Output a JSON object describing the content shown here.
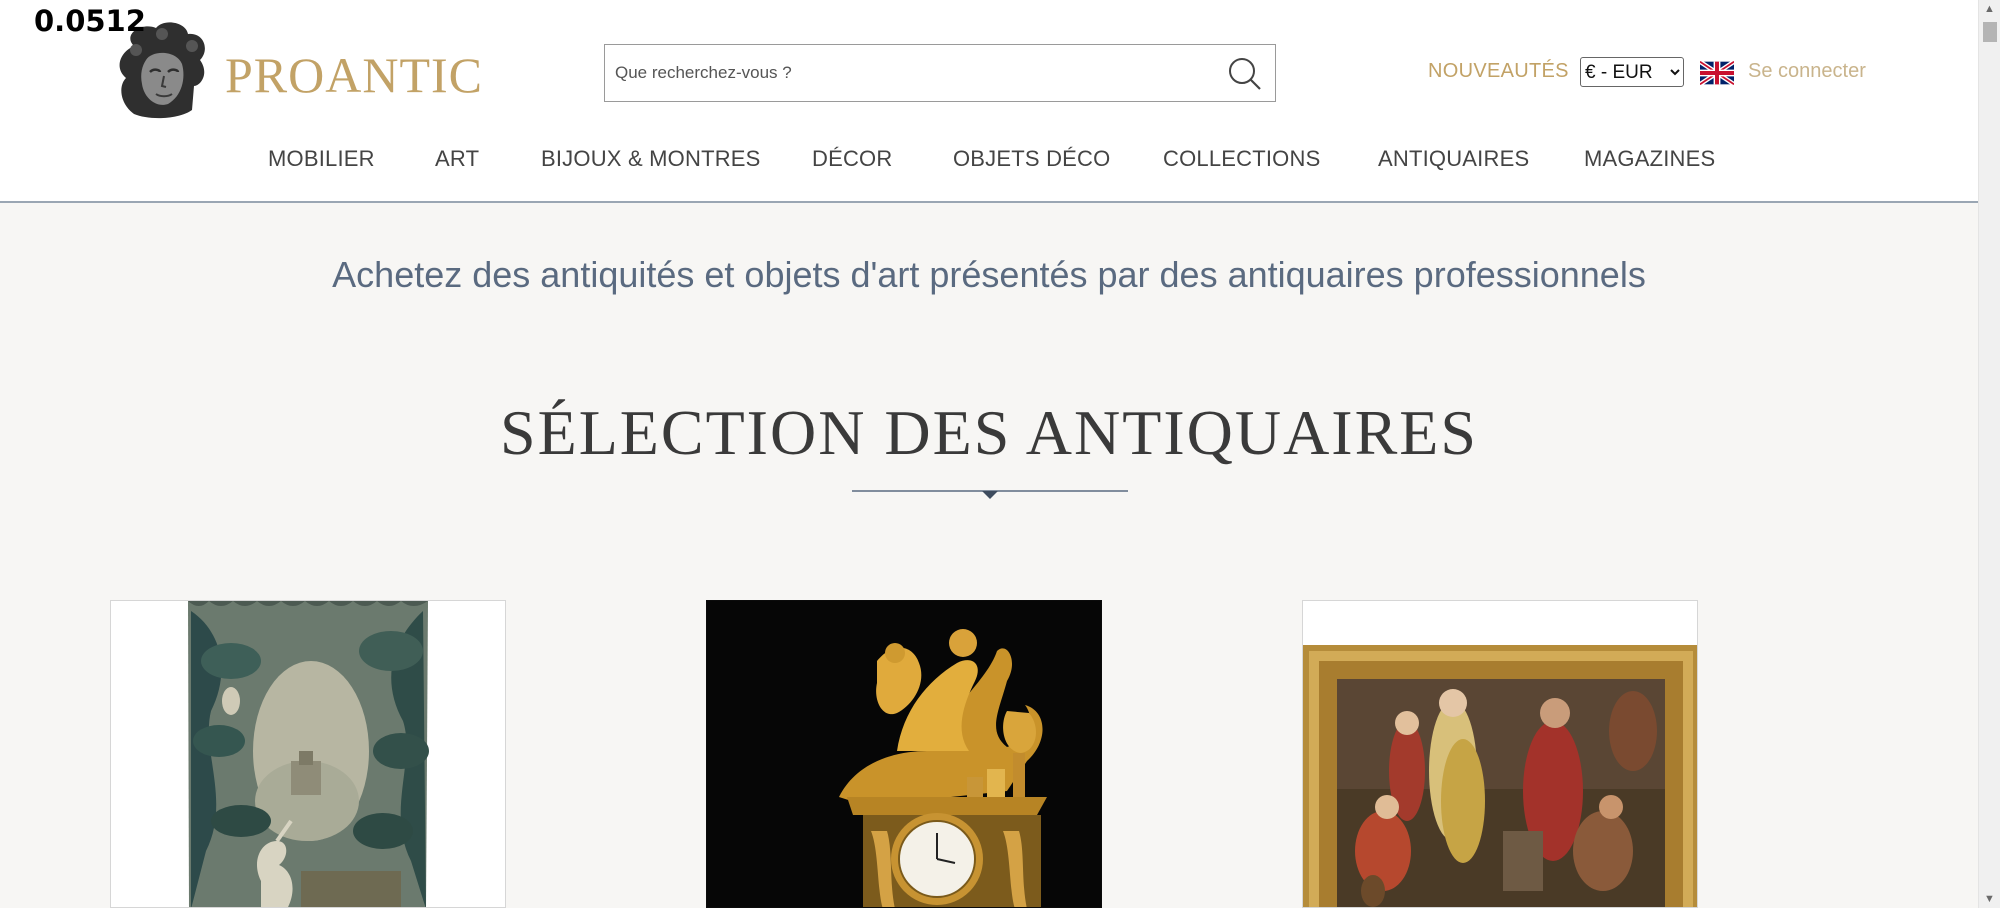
{
  "overlay_value": "0.0512",
  "brand": {
    "name": "PROANTIC",
    "logo_icon": "classical-head-bust-logo"
  },
  "search": {
    "placeholder": "Que recherchez-vous ?",
    "icon": "search-icon"
  },
  "header": {
    "new_label": "NOUVEAUTÉS",
    "currency_selected": "€ - EUR",
    "language_icon": "uk-flag-icon",
    "login_label": "Se connecter"
  },
  "nav": {
    "items": [
      {
        "label": "MOBILIER"
      },
      {
        "label": "ART"
      },
      {
        "label": "BIJOUX & MONTRES"
      },
      {
        "label": "DÉCOR"
      },
      {
        "label": "OBJETS DÉCO"
      },
      {
        "label": "COLLECTIONS"
      },
      {
        "label": "ANTIQUAIRES"
      },
      {
        "label": "MAGAZINES"
      }
    ]
  },
  "main": {
    "tagline": "Achetez des antiquités et objets d'art présentés par des antiquaires professionnels",
    "section_title": "SÉLECTION DES ANTIQUAIRES"
  },
  "products": [
    {
      "image": "verdure tapestry with bird and fountain"
    },
    {
      "image": "gilt bronze empire mantel clock"
    },
    {
      "image": "framed oil painting figures at a well"
    }
  ],
  "colors": {
    "brand_gold": "#c2a266",
    "tagline_blue": "#5a6a80",
    "background": "#f7f6f4"
  }
}
